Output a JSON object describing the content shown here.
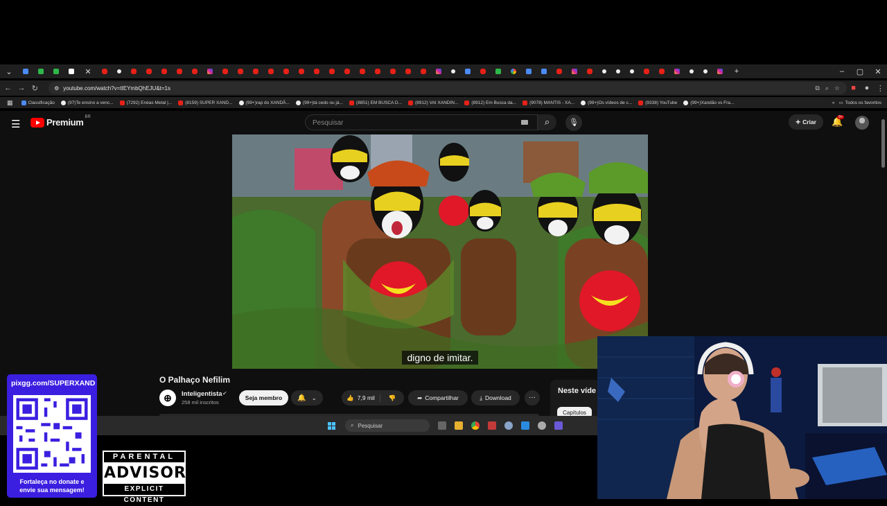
{
  "browser": {
    "url": "youtube.com/watch?v=tIEYmbQhEJU&t=1s",
    "window_controls": [
      "–",
      "▢",
      "✕"
    ],
    "bookmarks": [
      "Classificação",
      "(97)Te ensino a venc...",
      "(7292) Enéas Metal |...",
      "(8159) SUPER XAND...",
      "(99+)rap do XANDÃ...",
      "(99+)tá cedo ou já...",
      "(8851) EM BUSCA D...",
      "(8912) VAI XANDIN...",
      "(8912) Em Busca da...",
      "(9078) MANTIS - XA...",
      "(99+)Os vídeos de c...",
      "(9338) YouTube",
      "(99+)Xandão vs Fra..."
    ],
    "all_bookmarks": "Todos os favoritos"
  },
  "youtube": {
    "logo_text": "Premium",
    "logo_region": "BR",
    "search_placeholder": "Pesquisar",
    "create_label": "Criar",
    "notif_badge": "9+",
    "caption": "digno de imitar.",
    "video_title": "O Palhaço Nefilim",
    "channel_name": "Inteligentista",
    "subscribers": "258 mil inscritos",
    "member_label": "Seja membro",
    "likes": "7,9 mil",
    "share_label": "Compartilhar",
    "download_label": "Download",
    "side_title": "Neste víde",
    "chapters_label": "Capítulos"
  },
  "taskbar": {
    "search_label": "Pesquisar"
  },
  "overlay": {
    "qr_url": "pixgg.com/SUPERXAND",
    "qr_message_line1": "Fortaleça no donate e",
    "qr_message_line2": "envie sua mensagem!",
    "advisory_top": "PARENTAL",
    "advisory_main": "ADVISORY",
    "advisory_bottom": "EXPLICIT CONTENT"
  },
  "colors": {
    "youtube_red": "#ff0000",
    "qr_card": "#3b1fe0",
    "page_bg": "#0f0f0f"
  }
}
